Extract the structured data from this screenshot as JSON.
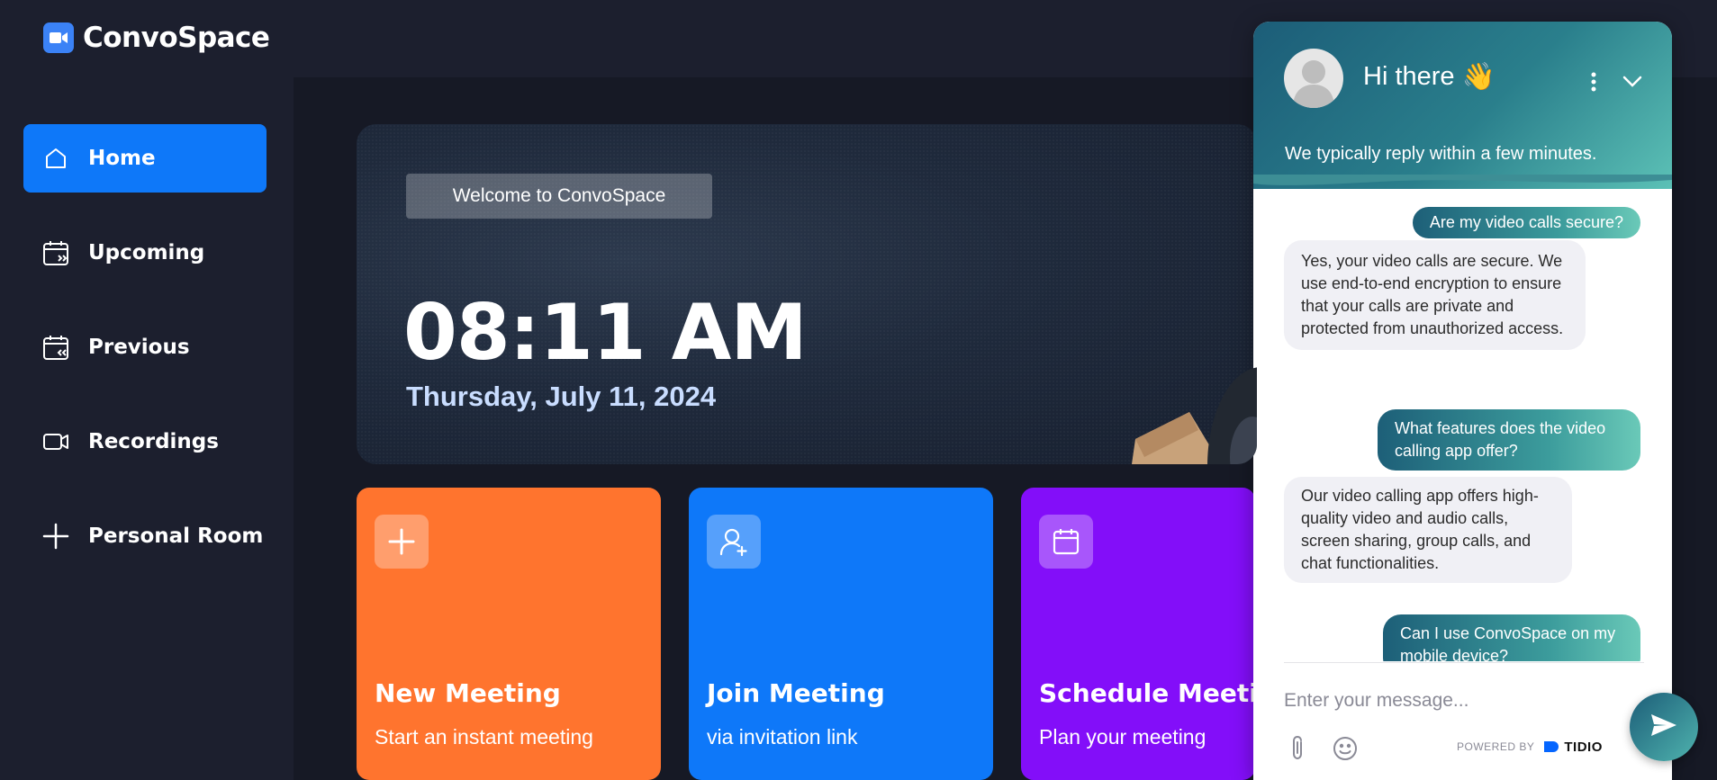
{
  "app": {
    "name": "ConvoSpace"
  },
  "sidebar": {
    "items": [
      {
        "label": "Home",
        "icon": "home-icon",
        "active": true
      },
      {
        "label": "Upcoming",
        "icon": "calendar-forward-icon",
        "active": false
      },
      {
        "label": "Previous",
        "icon": "calendar-back-icon",
        "active": false
      },
      {
        "label": "Recordings",
        "icon": "video-icon",
        "active": false
      },
      {
        "label": "Personal Room",
        "icon": "plus-icon",
        "active": false
      }
    ]
  },
  "hero": {
    "badge": "Welcome to ConvoSpace",
    "time": "08:11 AM",
    "date": "Thursday, July 11, 2024"
  },
  "cards": [
    {
      "title": "New Meeting",
      "subtitle": "Start an instant meeting",
      "icon": "plus-icon",
      "color": "#ff742e"
    },
    {
      "title": "Join Meeting",
      "subtitle": "via invitation link",
      "icon": "add-user-icon",
      "color": "#0e78f9"
    },
    {
      "title": "Schedule Meeting",
      "subtitle": "Plan your meeting",
      "icon": "calendar-icon",
      "color": "#830ef9"
    }
  ],
  "chat": {
    "title": "Hi there",
    "title_emoji": "👋",
    "subtitle": "We typically reply within a few minutes.",
    "messages": [
      {
        "from": "user",
        "text": "Are my video calls secure?"
      },
      {
        "from": "bot",
        "text": "Yes, your video calls are secure. We use end-to-end encryption to ensure that your calls are private and protected from unauthorized access."
      },
      {
        "from": "user",
        "text": "What features does the video calling app offer?"
      },
      {
        "from": "bot",
        "text": "Our video calling app offers high-quality video and audio calls, screen sharing, group calls, and chat functionalities."
      },
      {
        "from": "user",
        "text": "Can I use ConvoSpace on my mobile device?"
      }
    ],
    "input_placeholder": "Enter your message...",
    "powered_by": "POWERED BY",
    "brand": "TIDIO"
  },
  "colors": {
    "background": "#1c1f2e",
    "accent": "#0e78f9",
    "orange": "#ff742e",
    "purple": "#830ef9"
  }
}
